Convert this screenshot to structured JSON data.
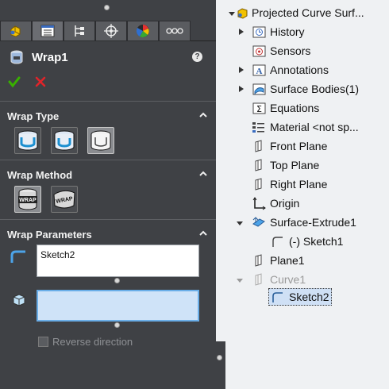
{
  "property_manager": {
    "title": "Wrap1",
    "help": "?",
    "tabs": [
      "feature-manager-icon",
      "property-manager-icon",
      "configuration-manager-icon",
      "dimxpert-icon",
      "display-manager-icon",
      "more-icon"
    ],
    "groups": {
      "wrap_type": {
        "label": "Wrap Type",
        "options": [
          "emboss",
          "deboss",
          "scribe"
        ]
      },
      "wrap_method": {
        "label": "Wrap Method",
        "options": [
          "analytical",
          "spline-surface"
        ]
      },
      "wrap_parameters": {
        "label": "Wrap Parameters",
        "source_sketch": "Sketch2",
        "face_value": "",
        "reverse_direction_label": "Reverse direction",
        "reverse_direction_checked": false
      }
    },
    "wrap_label": "WRAP"
  },
  "tree": {
    "root": "Projected Curve Surf...",
    "items": [
      {
        "label": "History",
        "icon": "history-icon",
        "expandable": true
      },
      {
        "label": "Sensors",
        "icon": "sensors-icon",
        "expandable": false
      },
      {
        "label": "Annotations",
        "icon": "annotations-icon",
        "expandable": true
      },
      {
        "label": "Surface Bodies(1)",
        "icon": "surface-bodies-icon",
        "expandable": true
      },
      {
        "label": "Equations",
        "icon": "equations-icon",
        "expandable": false
      },
      {
        "label": "Material <not sp...",
        "icon": "material-icon",
        "expandable": false
      },
      {
        "label": "Front Plane",
        "icon": "plane-icon",
        "expandable": false
      },
      {
        "label": "Top Plane",
        "icon": "plane-icon",
        "expandable": false
      },
      {
        "label": "Right Plane",
        "icon": "plane-icon",
        "expandable": false
      },
      {
        "label": "Origin",
        "icon": "origin-icon",
        "expandable": false
      },
      {
        "label": "Surface-Extrude1",
        "icon": "surface-extrude-icon",
        "expandable": true
      },
      {
        "label": "(-) Sketch1",
        "icon": "sketch-icon",
        "expandable": false
      },
      {
        "label": "Plane1",
        "icon": "plane-icon",
        "expandable": false
      },
      {
        "label": "Curve1",
        "icon": "curve-icon",
        "expandable": true
      },
      {
        "label": "Sketch2",
        "icon": "sketch-icon",
        "expandable": false
      }
    ]
  },
  "colors": {
    "panel": "#3f4145",
    "tree_bg": "#eff1f3",
    "accent": "#6aaee8",
    "ok": "#38b000",
    "cancel": "#e0242a"
  }
}
